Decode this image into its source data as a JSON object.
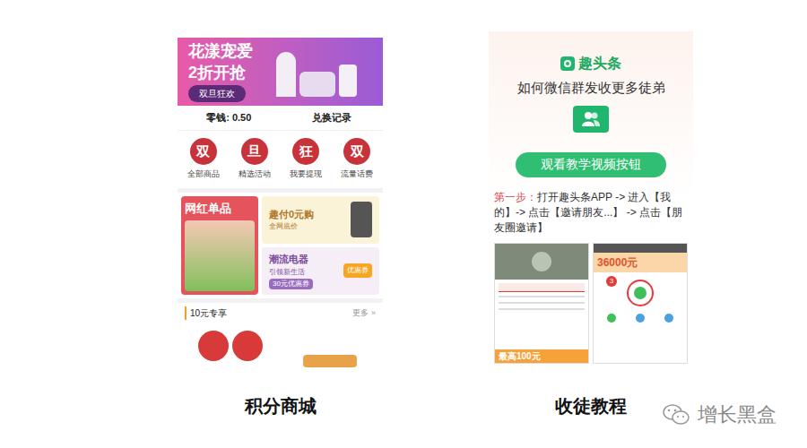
{
  "left_screen": {
    "banner": {
      "title": "花漾宠爱",
      "subtitle": "2折开抢",
      "button": "双旦狂欢"
    },
    "balance": "零钱: 0.50",
    "exchange": "兑换记录",
    "categories": [
      {
        "icon": "双",
        "label": "全部商品"
      },
      {
        "icon": "旦",
        "label": "精选活动"
      },
      {
        "icon": "狂",
        "label": "我要提现"
      },
      {
        "icon": "双",
        "label": "流量话费"
      }
    ],
    "featured": {
      "title": "网红单品"
    },
    "promo_top": {
      "title": "趣付0元购",
      "subtitle": "全网底价"
    },
    "promo_bottom": {
      "title": "潮流电器",
      "subtitle": "引领新生活",
      "coupon": "30元优惠券",
      "tag": "优惠券"
    },
    "section": {
      "title": "10元专享",
      "more": "更多 »"
    }
  },
  "right_screen": {
    "logo": "趣头条",
    "headline": "如何微信群发收更多徒弟",
    "button": "观看教学视频按钮",
    "step_label": "第一步：",
    "step_text": "打开趣头条APP -> 进入【我的】-> 点击【邀请朋友...】 -> 点击【朋友圈邀请】",
    "mini_left": {
      "banner": "最高100元"
    },
    "mini_right": {
      "amount": "36000元",
      "badge": "3"
    }
  },
  "captions": [
    "积分商城",
    "收徒教程"
  ],
  "watermark": "增长黑盒"
}
